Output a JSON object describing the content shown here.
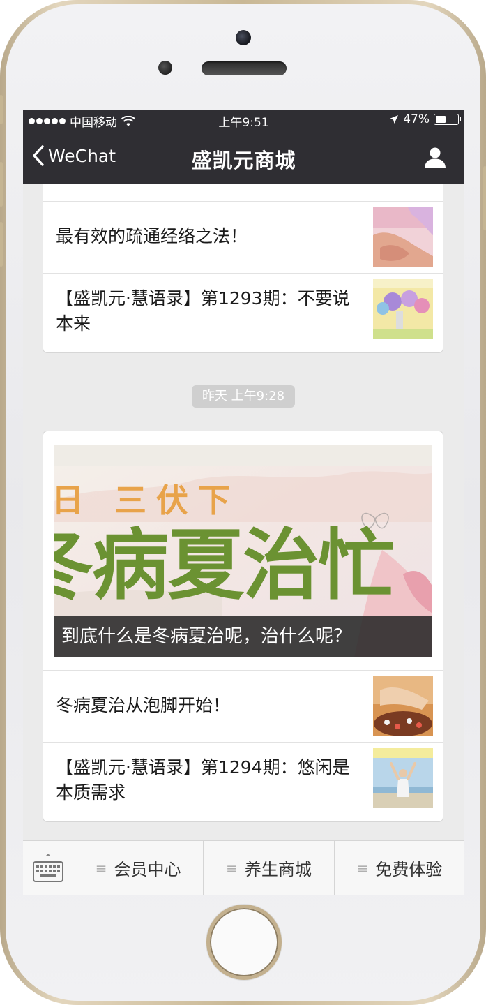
{
  "status_bar": {
    "carrier": "中国移动",
    "time": "上午9:51",
    "battery": "47%",
    "battery_level": 0.47
  },
  "nav": {
    "back_label": "WeChat",
    "title": "盛凯元商城",
    "back_icon": "chevron-left-icon",
    "profile_icon": "person-icon"
  },
  "message_group_1": {
    "articles": [
      {
        "title": "最有效的疏通经络之法！",
        "thumb": "massage-photo"
      },
      {
        "title": "【盛凯元·慧语录】第1293期：不要说本来",
        "thumb": "balloons-photo"
      }
    ]
  },
  "timestamp": "昨天 上午9:28",
  "message_group_2": {
    "banner": {
      "image_text_top": "日 三伏下",
      "image_text_main": "冬病夏治忙",
      "caption": "到底什么是冬病夏治呢，治什么呢？"
    },
    "articles": [
      {
        "title": "冬病夏治从泡脚开始！",
        "thumb": "foot-soak-photo"
      },
      {
        "title": "【盛凯元·慧语录】第1294期：悠闲是本质需求",
        "thumb": "yoga-beach-photo"
      }
    ]
  },
  "menu": {
    "keyboard_icon": "keyboard-icon",
    "items": [
      {
        "label": "会员中心"
      },
      {
        "label": "养生商城"
      },
      {
        "label": "免费体验"
      }
    ]
  }
}
